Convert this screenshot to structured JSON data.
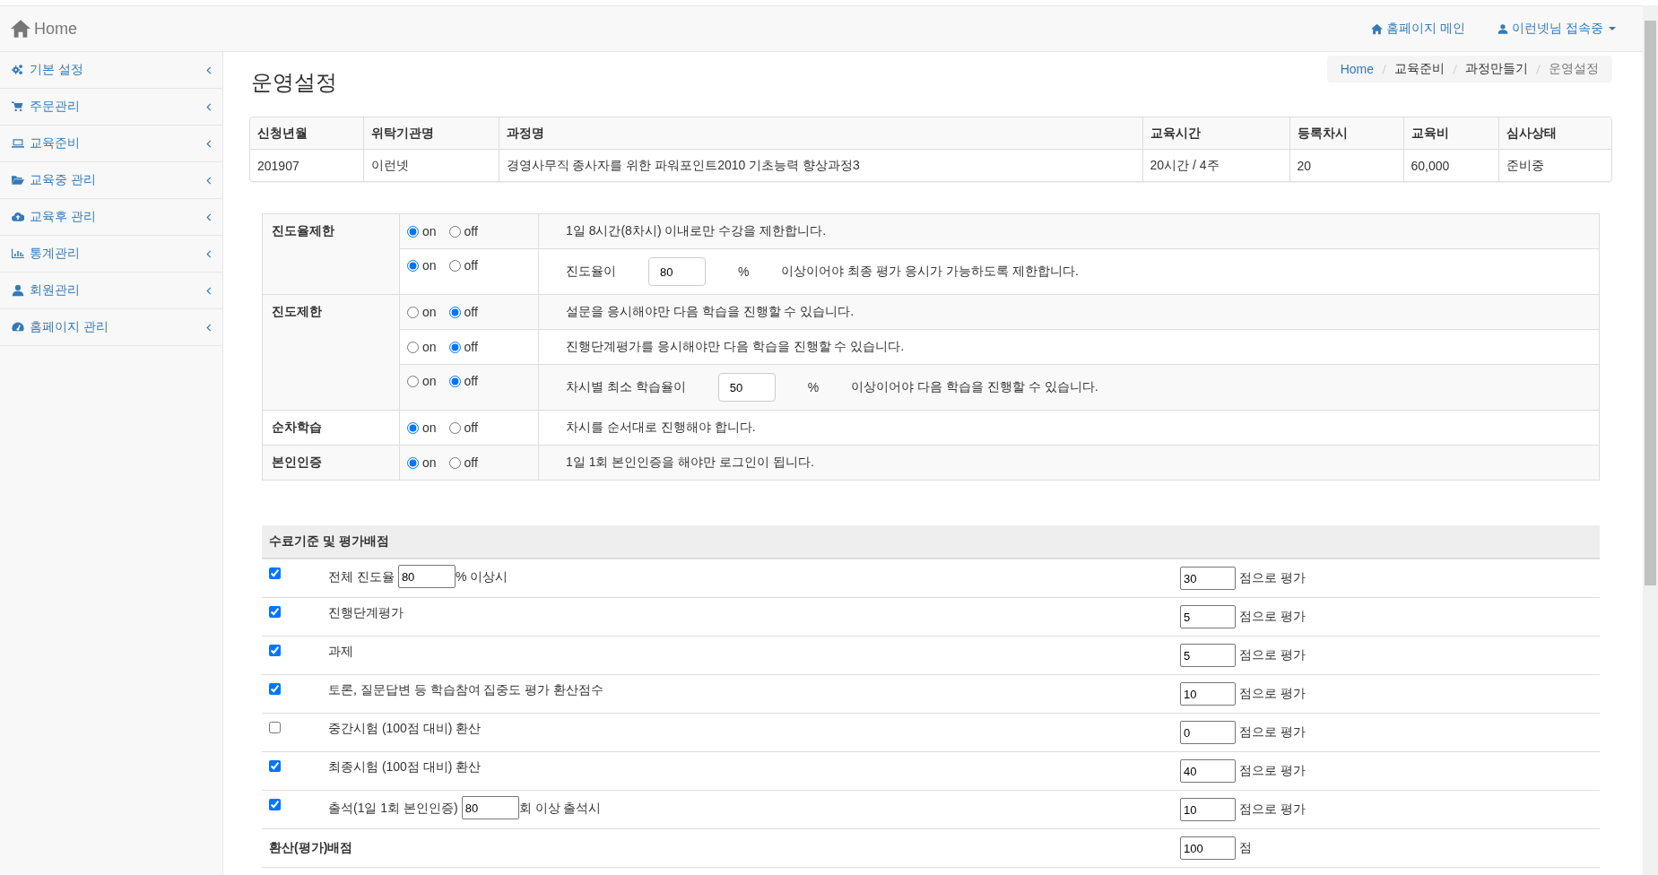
{
  "navbar": {
    "brand": "Home",
    "links": [
      {
        "kind": "home",
        "label": "홈페이지 메인"
      },
      {
        "kind": "user",
        "label": "이런넷님 접속중"
      }
    ]
  },
  "sidebar": {
    "items": [
      {
        "kind": "gears",
        "label": "기본 설정"
      },
      {
        "kind": "cart",
        "label": "주문관리"
      },
      {
        "kind": "laptop",
        "label": "교육준비"
      },
      {
        "kind": "folder",
        "label": "교육중 관리"
      },
      {
        "kind": "cloud",
        "label": "교육후 관리"
      },
      {
        "kind": "chart",
        "label": "통계관리"
      },
      {
        "kind": "user",
        "label": "회원관리"
      },
      {
        "kind": "dashboard",
        "label": "홈페이지 관리"
      }
    ]
  },
  "page_title": "운영설정",
  "breadcrumb": [
    {
      "kind": "link",
      "label": "Home"
    },
    {
      "kind": "text",
      "label": "교육준비"
    },
    {
      "kind": "text",
      "label": "과정만들기"
    },
    {
      "kind": "active",
      "label": "운영설정"
    }
  ],
  "course_table": {
    "columns": [
      "신청년월",
      "위탁기관명",
      "과정명",
      "교육시간",
      "등록차시",
      "교육비",
      "심사상태"
    ],
    "rows": [
      [
        "201907",
        "이런넷",
        "경영사무직 종사자를 위한 파워포인트2010 기초능력 향상과정3",
        "20시간 / 4주",
        "20",
        "60,000",
        "준비중"
      ]
    ]
  },
  "settings": [
    {
      "label": "진도율제한",
      "rows": [
        {
          "choices": [
            {
              "label": "on",
              "selected": true
            },
            {
              "label": "off",
              "selected": false
            }
          ],
          "kind": "text",
          "text": "1일 8시간(8차시) 이내로만 수강을 제한합니다."
        },
        {
          "choices": [
            {
              "label": "on",
              "selected": true
            },
            {
              "label": "off",
              "selected": false
            }
          ],
          "kind": "input",
          "before": "진도율이",
          "value": "80",
          "unit": "%",
          "after": "이상이어야 최종 평가 응시가 가능하도록 제한합니다."
        }
      ]
    },
    {
      "label": "진도제한",
      "rows": [
        {
          "choices": [
            {
              "label": "on",
              "selected": false
            },
            {
              "label": "off",
              "selected": true
            }
          ],
          "kind": "text",
          "text": "설문을 응시해야만 다음 학습을 진행할 수 있습니다."
        },
        {
          "choices": [
            {
              "label": "on",
              "selected": false
            },
            {
              "label": "off",
              "selected": true
            }
          ],
          "kind": "text",
          "text": "진행단계평가를 응시해야만 다음 학습을 진행할 수 있습니다."
        },
        {
          "choices": [
            {
              "label": "on",
              "selected": false
            },
            {
              "label": "off",
              "selected": true
            }
          ],
          "kind": "input",
          "before": "차시별 최소 학습율이",
          "value": "50",
          "unit": "%",
          "after": "이상이어야 다음 학습을 진행할 수 있습니다."
        }
      ]
    },
    {
      "label": "순차학습",
      "rows": [
        {
          "choices": [
            {
              "label": "on",
              "selected": true
            },
            {
              "label": "off",
              "selected": false
            }
          ],
          "kind": "text",
          "text": "차시를 순서대로 진행해야 합니다."
        }
      ]
    },
    {
      "label": "본인인증",
      "rows": [
        {
          "choices": [
            {
              "label": "on",
              "selected": true
            },
            {
              "label": "off",
              "selected": false
            }
          ],
          "kind": "text",
          "text": "1일 1회 본인인증을 해야만 로그인이 됩니다."
        }
      ]
    }
  ],
  "criteria": {
    "title": "수료기준 및 평가배점",
    "rows": [
      {
        "checked": true,
        "kind": "input",
        "before": "전체 진도율",
        "value": "80",
        "after": "% 이상시",
        "score": "30",
        "suffix": "점으로 평가"
      },
      {
        "checked": true,
        "kind": "text",
        "label": "진행단계평가",
        "score": "5",
        "suffix": "점으로 평가"
      },
      {
        "checked": true,
        "kind": "text",
        "label": "과제",
        "score": "5",
        "suffix": "점으로 평가"
      },
      {
        "checked": true,
        "kind": "text",
        "label": "토론, 질문답변 등 학습참여 집중도 평가 환산점수",
        "score": "10",
        "suffix": "점으로 평가"
      },
      {
        "checked": false,
        "kind": "text",
        "label": "중간시험 (100점 대비) 환산",
        "score": "0",
        "suffix": "점으로 평가"
      },
      {
        "checked": true,
        "kind": "text",
        "label": "최종시험 (100점 대비) 환산",
        "score": "40",
        "suffix": "점으로 평가"
      },
      {
        "checked": true,
        "kind": "input",
        "before": "출석(1일 1회 본인인증)",
        "value": "80",
        "after": "회 이상 출석시",
        "score": "10",
        "suffix": "점으로 평가"
      }
    ],
    "total": {
      "label": "환산(평가)배점",
      "value": "100",
      "suffix": "점"
    }
  }
}
